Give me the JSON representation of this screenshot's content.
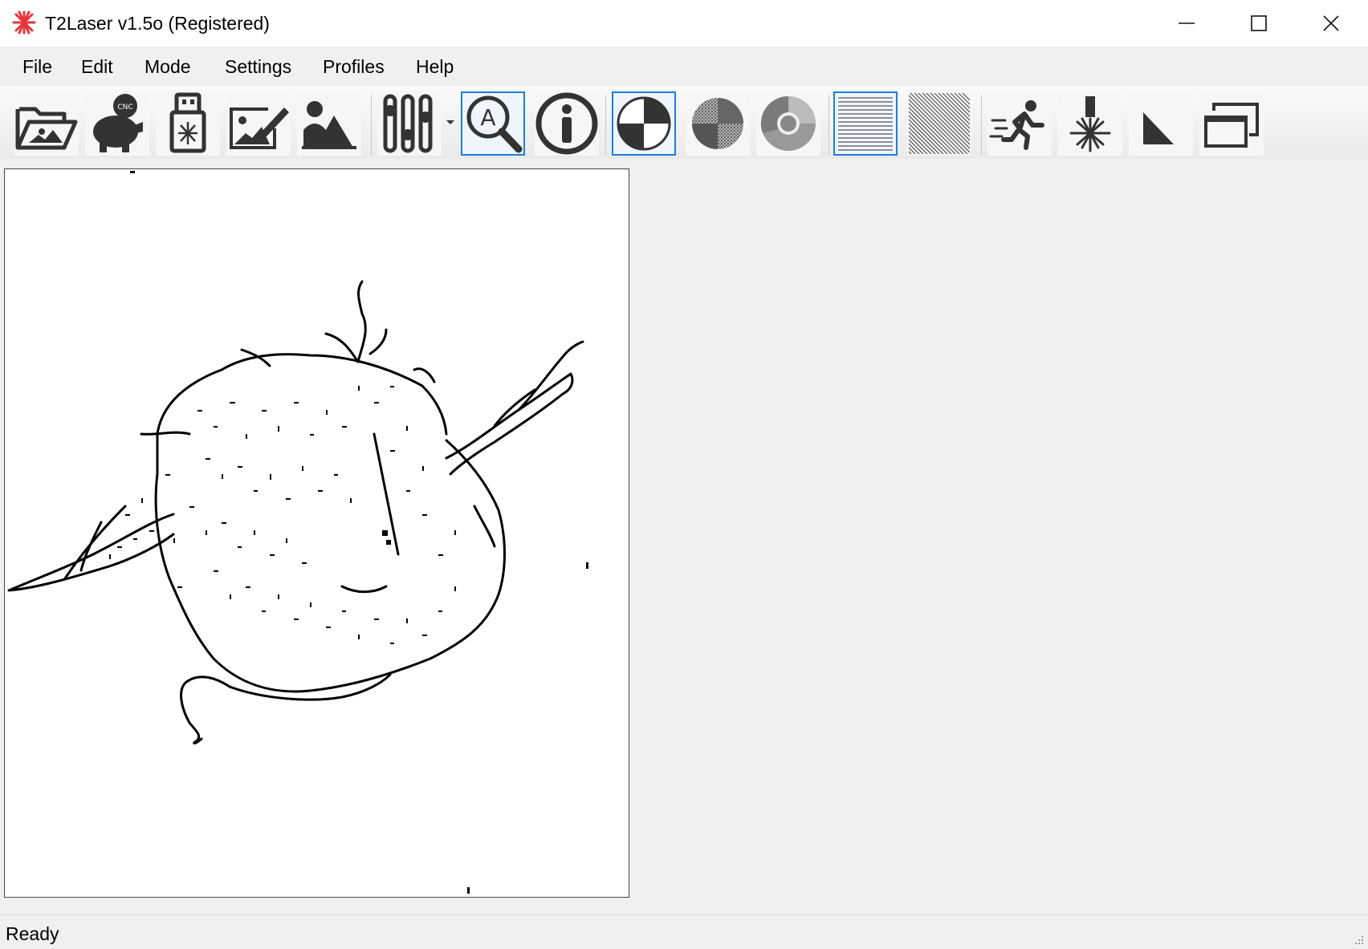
{
  "window": {
    "title": "T2Laser v1.5o (Registered)",
    "controls": [
      "minimize",
      "maximize",
      "close"
    ]
  },
  "menu": [
    "File",
    "Edit",
    "Mode",
    "Settings",
    "Profiles",
    "Help"
  ],
  "toolbar": {
    "buttons": [
      {
        "name": "open-image-button",
        "icon": "folder-image-icon",
        "active": false
      },
      {
        "name": "cnc-piggy-button",
        "icon": "piggy-bank-cnc-icon",
        "active": false
      },
      {
        "name": "usb-laser-button",
        "icon": "usb-laser-icon",
        "active": false
      },
      {
        "name": "edit-image-button",
        "icon": "image-edit-icon",
        "active": false
      },
      {
        "name": "photo-button",
        "icon": "person-mountain-icon",
        "active": false
      },
      {
        "name": "adjustments-button",
        "icon": "sliders-icon",
        "active": false
      },
      {
        "name": "auto-zoom-button",
        "icon": "magnifier-a-icon",
        "active": true
      },
      {
        "name": "info-button",
        "icon": "info-icon",
        "active": false
      },
      {
        "name": "threshold-mode-button",
        "icon": "threshold-circle-icon",
        "active": true
      },
      {
        "name": "dither-mode-button",
        "icon": "dither-circle-icon",
        "active": false
      },
      {
        "name": "grayscale-mode-button",
        "icon": "grayscale-circle-icon",
        "active": false
      },
      {
        "name": "horizontal-fill-button",
        "icon": "horizontal-lines-icon",
        "active": true
      },
      {
        "name": "diagonal-fill-button",
        "icon": "diagonal-lines-icon",
        "active": false
      },
      {
        "name": "run-button",
        "icon": "running-man-icon",
        "active": false
      },
      {
        "name": "laser-fire-button",
        "icon": "laser-burst-icon",
        "active": false
      },
      {
        "name": "ramp-button",
        "icon": "triangle-ramp-icon",
        "active": false
      },
      {
        "name": "windows-button",
        "icon": "cascade-windows-icon",
        "active": false
      }
    ]
  },
  "status": {
    "text": "Ready"
  },
  "colors": {
    "accent": "#1e7fd8",
    "app_icon": "#e8343c"
  }
}
